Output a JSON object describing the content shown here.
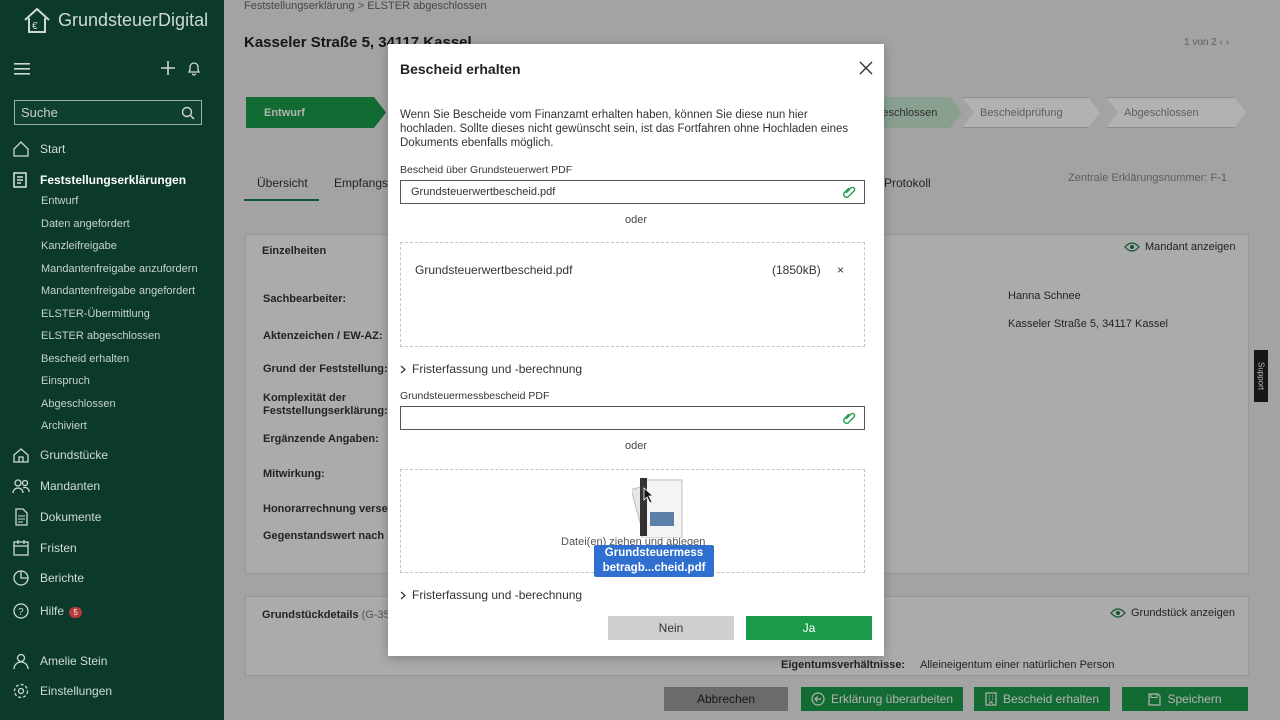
{
  "app": {
    "logo_text": "GrundsteuerDigital"
  },
  "sidebar": {
    "search_placeholder": "Suche",
    "items": [
      {
        "label": "Start",
        "icon": "home-icon"
      },
      {
        "label": "Feststellungserklärungen",
        "icon": "document-edit-icon"
      },
      {
        "label": "Grundstücke",
        "icon": "property-icon"
      },
      {
        "label": "Mandanten",
        "icon": "people-icon"
      },
      {
        "label": "Dokumente",
        "icon": "file-icon"
      },
      {
        "label": "Fristen",
        "icon": "calendar-icon"
      },
      {
        "label": "Berichte",
        "icon": "pie-chart-icon"
      },
      {
        "label": "Hilfe",
        "icon": "help-icon",
        "badge": "5"
      },
      {
        "label": "Amelie Stein",
        "icon": "user-icon"
      },
      {
        "label": "Einstellungen",
        "icon": "settings-icon"
      }
    ],
    "sub_items": [
      "Entwurf",
      "Daten angefordert",
      "Kanzleifreigabe",
      "Mandantenfreigabe anzufordern",
      "Mandantenfreigabe angefordert",
      "ELSTER-Übermittlung",
      "ELSTER abgeschlossen",
      "Bescheid erhalten",
      "Einspruch",
      "Abgeschlossen",
      "Archiviert"
    ]
  },
  "main": {
    "breadcrumb": [
      "Feststellungserklärung",
      "ELSTER abgeschlossen"
    ],
    "title": "Kasseler Straße 5, 34117 Kassel",
    "pager": "1 von 2",
    "steps": [
      {
        "label": "Entwurf",
        "state": "active"
      },
      {
        "label": "abgeschlossen",
        "state": "done"
      },
      {
        "label": "Bescheidprüfung",
        "state": "pending"
      },
      {
        "label": "Abgeschlossen",
        "state": "pending"
      }
    ],
    "tabs": [
      "Übersicht",
      "Empfangs",
      "Protokoll"
    ],
    "zentrale": "Zentrale Erklärungsnummer: F-1",
    "details": {
      "title": "Einzelheiten",
      "show_mandant": "Mandant anzeigen",
      "labels": [
        "Sachbearbeiter:",
        "Aktenzeichen / EW-AZ:",
        "Grund der Feststellung:",
        "Komplexität der Feststellungserklärung:",
        "Ergänzende Angaben:",
        "Mitwirkung:",
        "Honorarrechnung verse",
        "Gegenstandswert nach S"
      ],
      "sachbearbeiter_value": "Hanna Schnee",
      "address_value": "Kasseler Straße 5, 34117 Kassel"
    },
    "grundstueck": {
      "title": "Grundstückdetails",
      "suffix": "(G-35",
      "show_link": "Grundstück anzeigen",
      "eigentum_label": "Eigentumsverhältnisse:",
      "eigentum_value": "Alleineigentum einer natürlichen Person"
    },
    "support_label": "Support",
    "buttons": {
      "cancel": "Abbrechen",
      "revise": "Erklärung überarbeiten",
      "notice": "Bescheid erhalten",
      "save": "Speichern"
    }
  },
  "modal": {
    "title": "Bescheid erhalten",
    "description": "Wenn Sie Bescheide vom Finanzamt erhalten haben, können Sie diese nun hier hochladen. Sollte dieses nicht gewünscht sein, ist das Fortfahren ohne Hochladen eines Dokuments ebenfalls möglich.",
    "field1_label": "Bescheid über Grundsteuerwert PDF",
    "field1_value": "Grundsteuerwertbescheid.pdf",
    "or_label": "oder",
    "uploaded_file": {
      "name": "Grundsteuerwertbescheid.pdf",
      "size": "(1850kB)",
      "remove": "×"
    },
    "frist_label": "Fristerfassung und -berechnung",
    "field2_label": "Grundsteuermessbescheid PDF",
    "field2_value": "",
    "drop_text": "Datei(en) ziehen und ablegen",
    "drag_label_line1": "Grundsteuermess",
    "drag_label_line2": "betragb...cheid.pdf",
    "btn_no": "Nein",
    "btn_yes": "Ja"
  },
  "colors": {
    "sidebar_bg": "#0b3a2c",
    "primary_green": "#1a9a4a",
    "drag_blue": "#2f6fcf"
  }
}
